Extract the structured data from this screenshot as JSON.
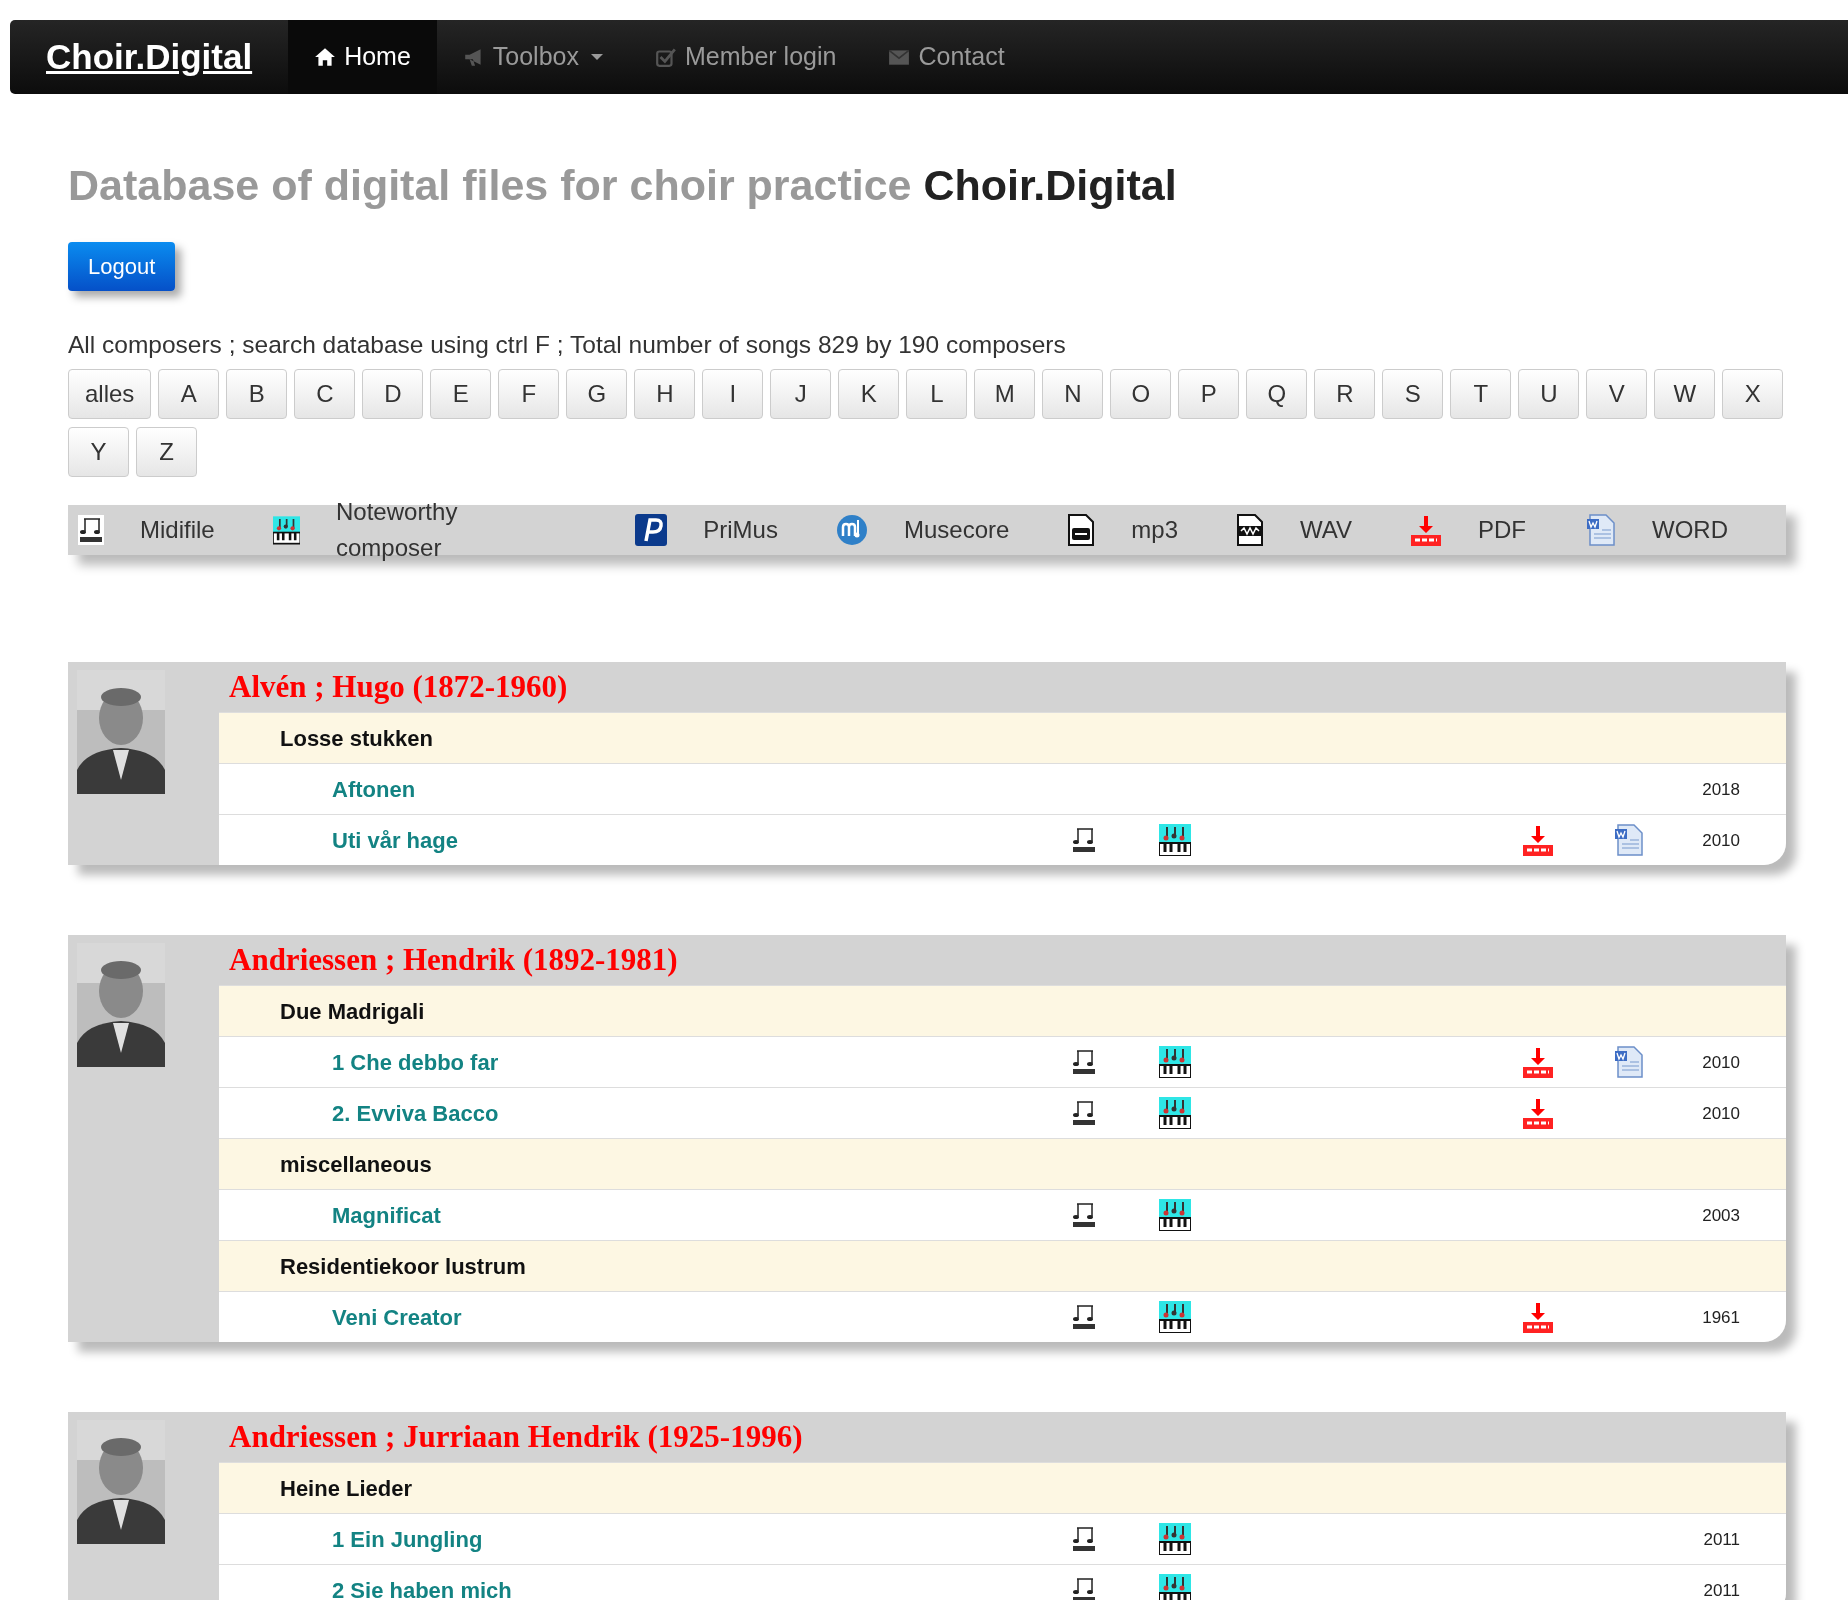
{
  "navbar": {
    "brand": "Choir.Digital",
    "items": [
      {
        "label": "Home",
        "selected": true,
        "dropdown": false
      },
      {
        "label": "Toolbox",
        "selected": false,
        "dropdown": true
      },
      {
        "label": "Member login",
        "selected": false,
        "dropdown": false
      },
      {
        "label": "Contact",
        "selected": false,
        "dropdown": false
      }
    ]
  },
  "heading": {
    "text": "Database of digital files for choir practice",
    "brand": "Choir.Digital"
  },
  "logout_button": "Logout",
  "info": "All composers ; search database using ctrl F ; Total number of songs 829 by 190 composers",
  "letters": [
    "alles",
    "A",
    "B",
    "C",
    "D",
    "E",
    "F",
    "G",
    "H",
    "I",
    "J",
    "K",
    "L",
    "M",
    "N",
    "O",
    "P",
    "Q",
    "R",
    "S",
    "T",
    "U",
    "V",
    "W",
    "X",
    "Y",
    "Z"
  ],
  "legend": [
    {
      "kind": "midi",
      "label": "Midifile"
    },
    {
      "kind": "nwc",
      "label": "Noteworthy composer"
    },
    {
      "kind": "primus",
      "label": "PriMus"
    },
    {
      "kind": "musecore",
      "label": "Musecore"
    },
    {
      "kind": "mp3",
      "label": "mp3"
    },
    {
      "kind": "wav",
      "label": "WAV"
    },
    {
      "kind": "pdf",
      "label": "PDF"
    },
    {
      "kind": "word",
      "label": "WORD"
    }
  ],
  "composers": [
    {
      "name": "Alvén ; Hugo (1872-1960)",
      "photo": {
        "kind": "picture"
      },
      "groups": [
        {
          "title": "Losse stukken",
          "songs": [
            {
              "title": "Aftonen",
              "midi": false,
              "nwc": false,
              "pdf": false,
              "word": false,
              "year": "2018"
            },
            {
              "title": "Uti vår hage",
              "midi": true,
              "nwc": true,
              "pdf": true,
              "word": true,
              "year": "2010"
            }
          ]
        }
      ]
    },
    {
      "name": "Andriessen ; Hendrik (1892-1981)",
      "photo": {
        "kind": "picture"
      },
      "groups": [
        {
          "title": "Due Madrigali",
          "songs": [
            {
              "title": "1 Che debbo far",
              "midi": true,
              "nwc": true,
              "pdf": true,
              "word": true,
              "year": "2010"
            },
            {
              "title": "2. Evviva Bacco",
              "midi": true,
              "nwc": true,
              "pdf": true,
              "word": false,
              "year": "2010"
            }
          ]
        },
        {
          "title": "miscellaneous",
          "songs": [
            {
              "title": "Magnificat",
              "midi": true,
              "nwc": true,
              "pdf": false,
              "word": false,
              "year": "2003"
            }
          ]
        },
        {
          "title": "Residentiekoor lustrum",
          "songs": [
            {
              "title": "Veni Creator",
              "midi": true,
              "nwc": true,
              "pdf": true,
              "word": false,
              "year": "1961"
            }
          ]
        }
      ]
    },
    {
      "name": "Andriessen ; Jurriaan Hendrik (1925-1996)",
      "photo": {
        "kind": "picture"
      },
      "groups": [
        {
          "title": "Heine Lieder",
          "songs": [
            {
              "title": "1 Ein Jungling",
              "midi": true,
              "nwc": true,
              "pdf": false,
              "word": false,
              "year": "2011"
            },
            {
              "title": "2 Sie haben mich",
              "midi": true,
              "nwc": true,
              "pdf": false,
              "word": false,
              "year": "2011"
            }
          ]
        }
      ]
    }
  ]
}
